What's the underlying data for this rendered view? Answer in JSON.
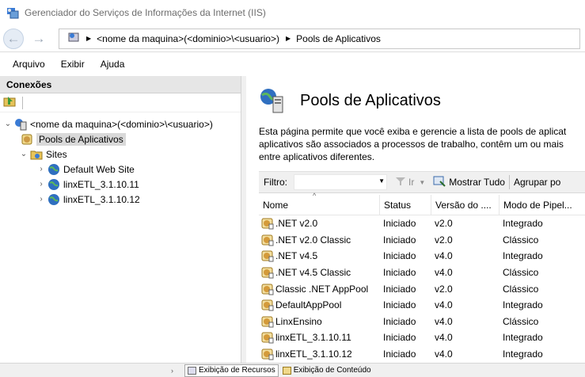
{
  "window": {
    "title": "Gerenciador do Serviços de Informações da Internet (IIS)"
  },
  "address": {
    "segments": [
      "<nome da maquina>(<dominio>\\<usuario>)",
      "Pools de Aplicativos"
    ]
  },
  "menu": [
    "Arquivo",
    "Exibir",
    "Ajuda"
  ],
  "connections": {
    "header": "Conexões",
    "tree": [
      {
        "label": "<nome da maquina>(<dominio>\\<usuario>)",
        "icon": "server-icon"
      },
      {
        "label": "Pools de Aplicativos",
        "icon": "app-pools-icon",
        "selected": true
      },
      {
        "label": "Sites",
        "icon": "sites-folder-icon"
      },
      {
        "label": "Default Web Site",
        "icon": "globe-icon"
      },
      {
        "label": "linxETL_3.1.10.11",
        "icon": "globe-icon"
      },
      {
        "label": "linxETL_3.1.10.12",
        "icon": "globe-icon"
      }
    ]
  },
  "page": {
    "title": "Pools de Aplicativos",
    "description": [
      "Esta página permite que você exiba e gerencie a lista de pools de aplicat",
      "aplicativos são associados a processos de trabalho, contêm um ou mais",
      "entre aplicativos diferentes."
    ]
  },
  "filter": {
    "label": "Filtro:",
    "go_label": "Ir",
    "show_all_label": "Mostrar Tudo",
    "group_label": "Agrupar po"
  },
  "table": {
    "columns": [
      "Nome",
      "Status",
      "Versão do ....",
      "Modo de Pipel..."
    ],
    "rows": [
      [
        ".NET v2.0",
        "Iniciado",
        "v2.0",
        "Integrado"
      ],
      [
        ".NET v2.0 Classic",
        "Iniciado",
        "v2.0",
        "Clássico"
      ],
      [
        ".NET v4.5",
        "Iniciado",
        "v4.0",
        "Integrado"
      ],
      [
        ".NET v4.5 Classic",
        "Iniciado",
        "v4.0",
        "Clássico"
      ],
      [
        "Classic .NET AppPool",
        "Iniciado",
        "v2.0",
        "Clássico"
      ],
      [
        "DefaultAppPool",
        "Iniciado",
        "v4.0",
        "Integrado"
      ],
      [
        "LinxEnsino",
        "Iniciado",
        "v4.0",
        "Clássico"
      ],
      [
        "linxETL_3.1.10.11",
        "Iniciado",
        "v4.0",
        "Integrado"
      ],
      [
        "linxETL_3.1.10.12",
        "Iniciado",
        "v4.0",
        "Integrado"
      ]
    ]
  },
  "status_bar": {
    "features_view": "Exibição de Recursos",
    "content_view": "Exibição de Conteúdo"
  }
}
